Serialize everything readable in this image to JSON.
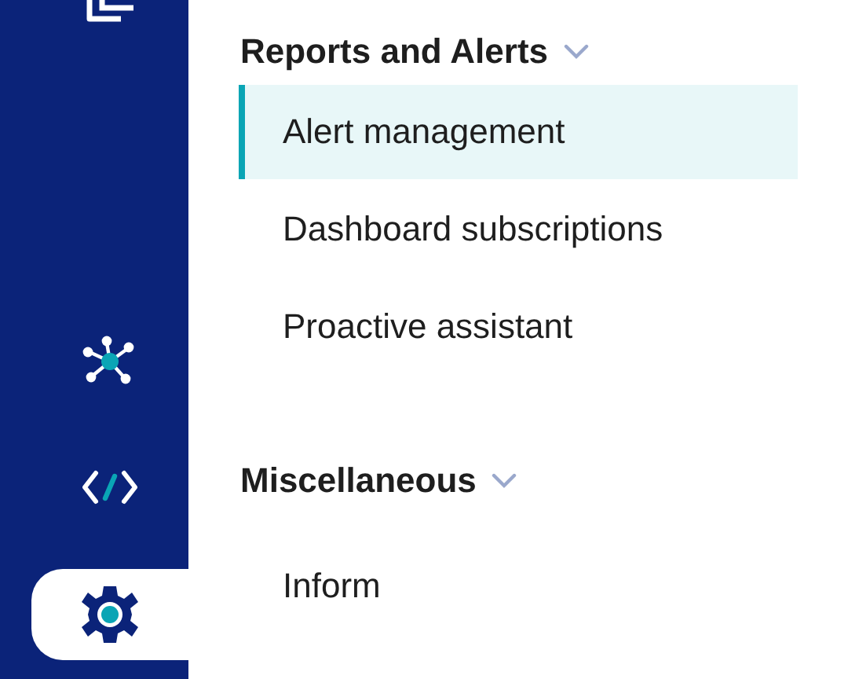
{
  "sidebar": {
    "items": [
      {
        "kind": "copy",
        "selected": false
      },
      {
        "kind": "network",
        "selected": false
      },
      {
        "kind": "code",
        "selected": false
      },
      {
        "kind": "settings",
        "selected": true
      }
    ]
  },
  "sections": [
    {
      "title": "Reports and Alerts",
      "expanded": true,
      "items": [
        {
          "label": "Alert management",
          "selected": true
        },
        {
          "label": "Dashboard subscriptions",
          "selected": false
        },
        {
          "label": "Proactive assistant",
          "selected": false
        }
      ]
    },
    {
      "title": "Miscellaneous",
      "expanded": true,
      "items": [
        {
          "label": "Inform",
          "selected": false
        }
      ]
    }
  ]
}
